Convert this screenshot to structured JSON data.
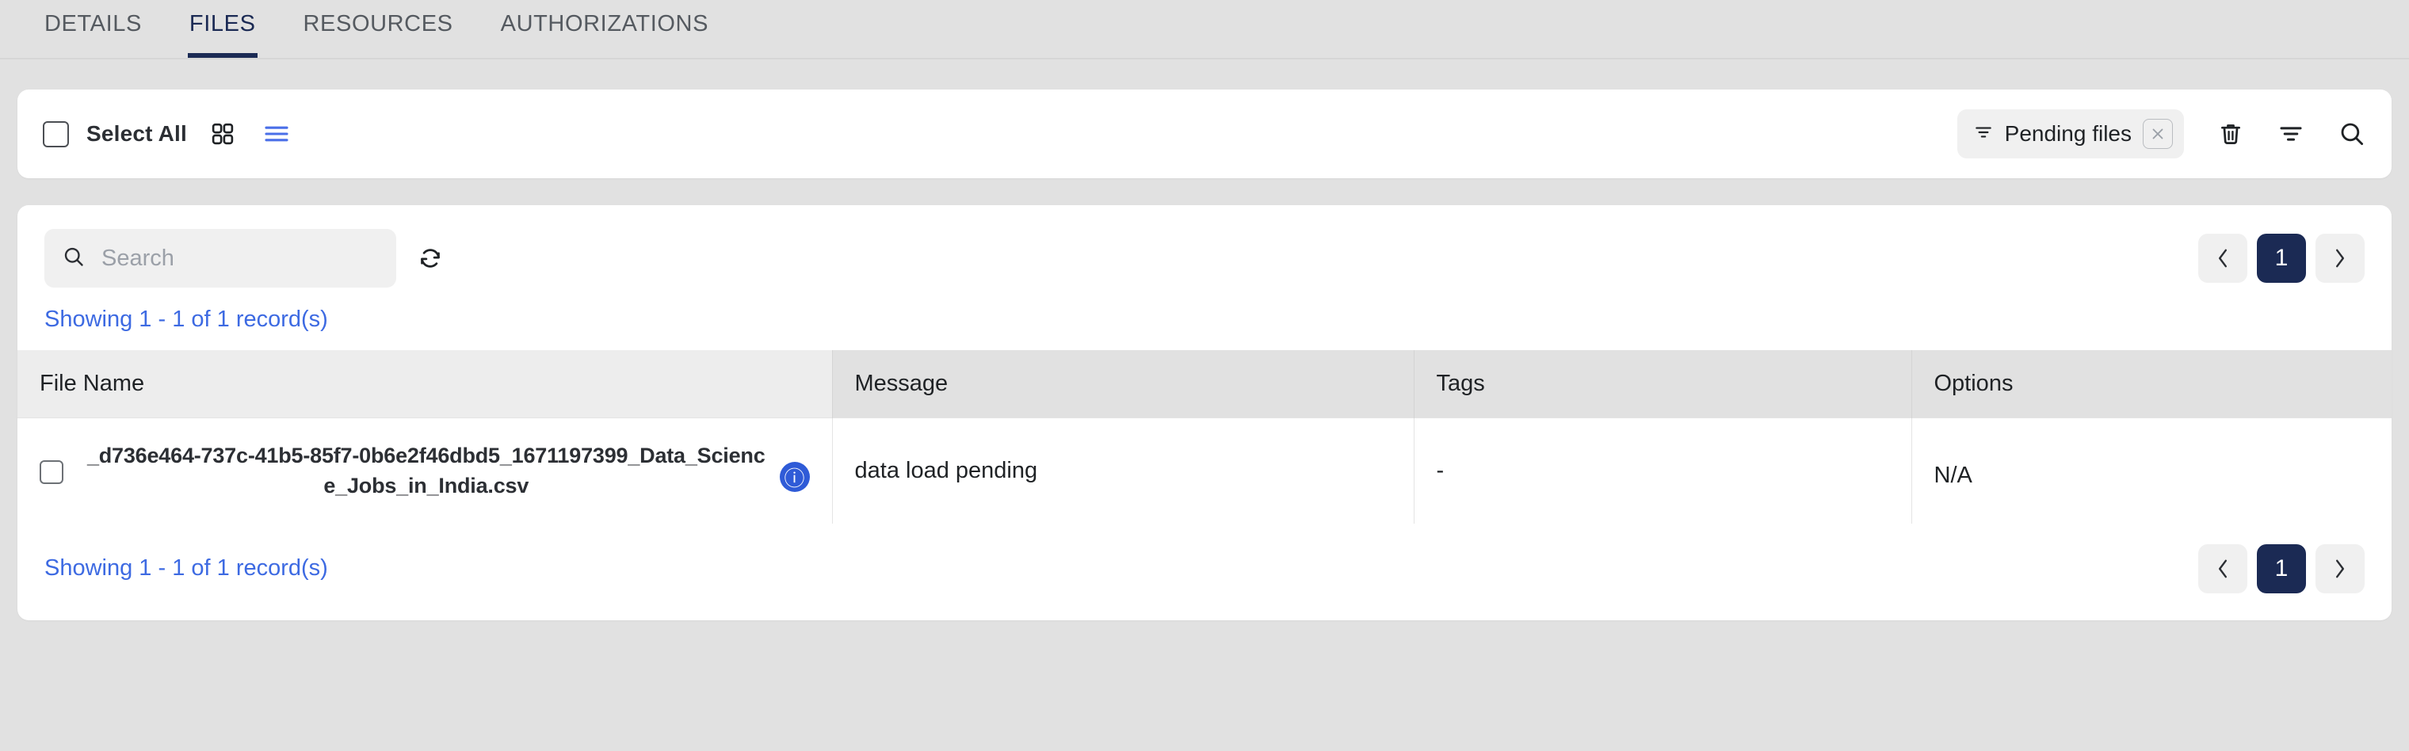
{
  "tabs": [
    {
      "label": "DETAILS",
      "active": false
    },
    {
      "label": "FILES",
      "active": true
    },
    {
      "label": "RESOURCES",
      "active": false
    },
    {
      "label": "AUTHORIZATIONS",
      "active": false
    }
  ],
  "toolbar": {
    "select_all_label": "Select All",
    "grid_view_icon": "grid-view-icon",
    "list_view_icon": "list-view-icon",
    "filter_chip": {
      "label": "Pending files",
      "leading_icon": "filter-icon",
      "remove_icon": "close-icon"
    },
    "delete_icon": "trash-icon",
    "filter_icon": "filter-icon",
    "search_icon": "search-icon"
  },
  "search": {
    "value": "",
    "placeholder": "Search",
    "icon": "search-icon",
    "refresh_icon": "refresh-icon"
  },
  "pagination": {
    "prev_label": "‹",
    "next_label": "›",
    "current_page": "1"
  },
  "records_summary": "Showing 1 - 1 of 1 record(s)",
  "table": {
    "columns": [
      "File Name",
      "Message",
      "Tags",
      "Options"
    ],
    "rows": [
      {
        "file_name": "_d736e464-737c-41b5-85f7-0b6e2f46dbd5_1671197399_Data_Science_Jobs_in_India.csv",
        "info_glyph": "ⓘ",
        "message": "data load pending",
        "tags": "-",
        "options": "N/A"
      }
    ]
  },
  "colors": {
    "accent_navy": "#1b2a54",
    "link_blue": "#3d6ae2",
    "info_blue": "#2f5bd7",
    "page_bg": "#e1e1e1",
    "card_bg": "#ffffff",
    "chip_bg": "#f0f0f0"
  }
}
